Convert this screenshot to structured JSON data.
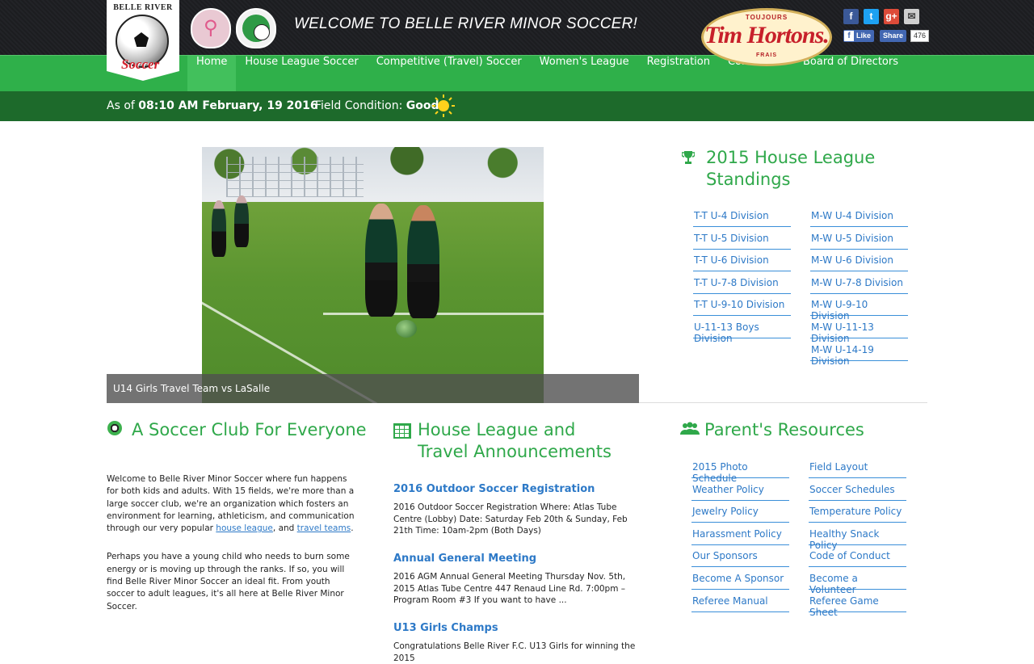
{
  "header": {
    "logo_top": "BELLE RIVER",
    "logo_script": "Soccer",
    "welcome": "WELCOME TO BELLE RIVER MINOR SOCCER!",
    "sponsor": {
      "top": "TOUJOURS",
      "name": "Tim Hortons.",
      "bottom": "FRAIS"
    },
    "social": {
      "facebook": "f",
      "twitter": "t",
      "googleplus": "g+",
      "email": "✉"
    },
    "like_label": "Like",
    "share_label": "Share",
    "like_count": "476"
  },
  "nav": [
    "Home",
    "House League Soccer",
    "Competitive (Travel) Soccer",
    "Women's League",
    "Registration",
    "Contact Us",
    "Board of Directors"
  ],
  "status": {
    "asof_prefix": "As of",
    "asof_value": "08:10 AM February, 19 2016",
    "field_prefix": "Field Condition:",
    "field_value": "Good"
  },
  "hero": {
    "caption": "U14 Girls Travel Team vs LaSalle"
  },
  "standings": {
    "title": "2015 House League Standings",
    "left": [
      "T-T U-4 Division",
      "T-T U-5 Division",
      "T-T U-6 Division",
      "T-T U-7-8 Division",
      "T-T U-9-10 Division",
      "U-11-13 Boys Division"
    ],
    "right": [
      "M-W U-4 Division",
      "M-W U-5 Division",
      "M-W U-6 Division",
      "M-W U-7-8 Division",
      "M-W U-9-10 Division",
      "M-W U-11-13 Division",
      "M-W U-14-19 Division"
    ]
  },
  "club": {
    "title": "A Soccer Club For Everyone",
    "p1_a": "Welcome to Belle River Minor Soccer where fun happens for both kids and adults. With 15 fields, we're more than a large soccer club, we're an organization which fosters an environment for learning, athleticism, and communication through our very popular ",
    "p1_link1": "house league",
    "p1_b": ", and ",
    "p1_link2": "travel teams",
    "p1_c": ".",
    "p2": "Perhaps you have a young child who needs to burn some energy or is moving up through the ranks. If so, you will find Belle River Minor Soccer an ideal fit. From youth soccer to adult leagues, it's all here at Belle River Minor Soccer."
  },
  "announcements": {
    "title": "House League and Travel Announcements",
    "items": [
      {
        "title": "2016 Outdoor Soccer Registration",
        "body": "2016 Outdoor Soccer Registration Where: Atlas Tube Centre (Lobby) Date: Saturday Feb 20th & Sunday, Feb 21th Time: 10am-2pm (Both Days)"
      },
      {
        "title": "Annual General Meeting",
        "body": "2016 AGM Annual General Meeting Thursday Nov. 5th, 2015 Atlas Tube Centre 447 Renaud Line Rd. 7:00pm – Program Room #3 If you want to have ..."
      },
      {
        "title": "U13 Girls Champs",
        "body": "Congratulations Belle River F.C. U13 Girls for winning the 2015"
      }
    ]
  },
  "resources": {
    "title": "Parent's Resources",
    "left": [
      "2015 Photo Schedule",
      "Weather Policy",
      "Jewelry Policy",
      "Harassment Policy",
      "Our Sponsors",
      "Become A Sponsor",
      "Referee Manual"
    ],
    "right": [
      "Field Layout",
      "Soccer Schedules",
      "Temperature Policy",
      "Healthy Snack Policy",
      "Code of Conduct",
      "Become a Volunteer",
      "Referee Game Sheet"
    ]
  },
  "colors": {
    "nav_green": "#2fb04a",
    "status_green": "#1d6a2b",
    "title_green": "#2fa84a",
    "link_blue": "#2d79c7"
  }
}
